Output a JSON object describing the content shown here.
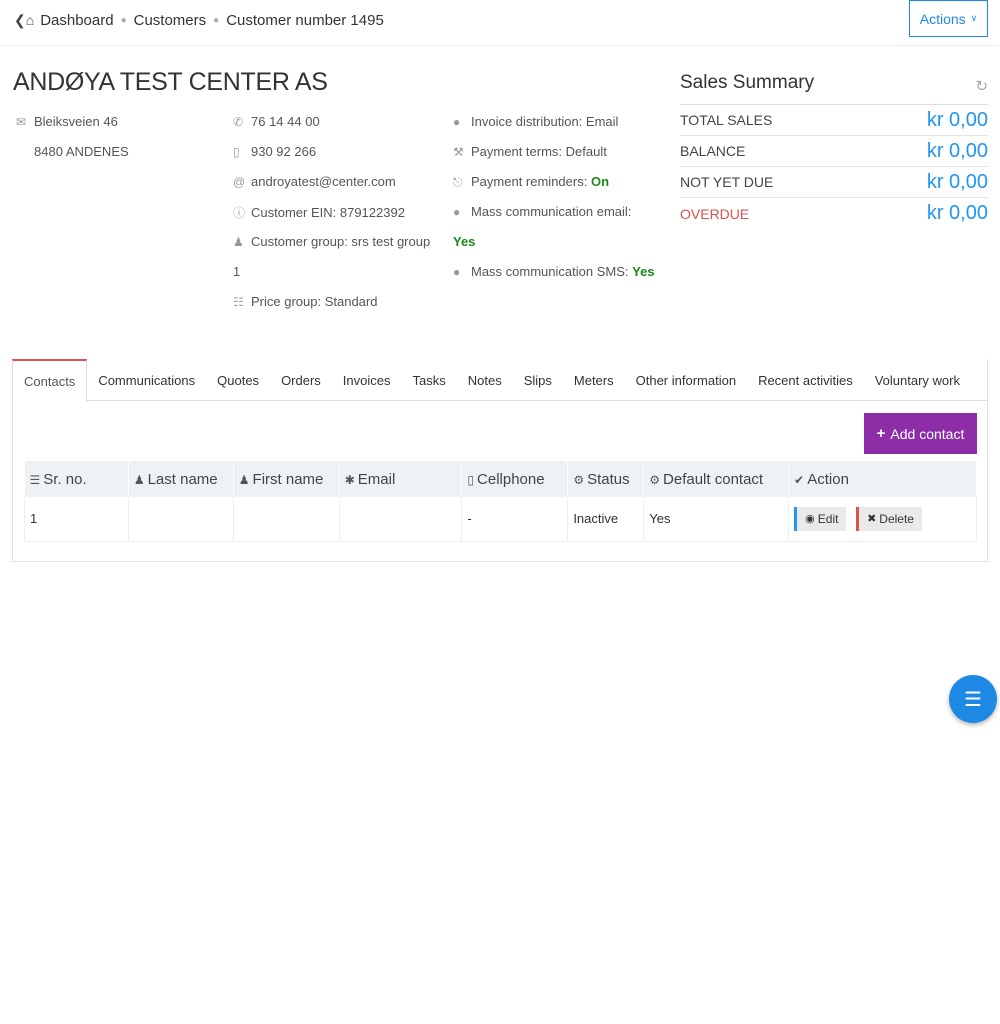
{
  "breadcrumb": {
    "items": [
      "Dashboard",
      "Customers",
      "Customer number 1495"
    ]
  },
  "actions_label": "Actions",
  "customer": {
    "name": "ANDØYA TEST CENTER AS",
    "address_line1": "Bleiksveien 46",
    "address_line2": "8480 ANDENES",
    "phone": "76 14 44 00",
    "mobile": "930 92 266",
    "email": "androyatest@center.com",
    "ein": "Customer EIN: 879122392",
    "group": "Customer group: srs test group",
    "group_cont": "1",
    "price_group": "Price group: Standard",
    "invoice_distribution": "Invoice distribution: Email",
    "payment_terms": "Payment terms: Default",
    "payment_reminders_label": "Payment reminders:",
    "payment_reminders_value": "On",
    "mass_email_label": "Mass communication email:",
    "mass_email_value": "Yes",
    "mass_sms_label": "Mass communication SMS:",
    "mass_sms_value": "Yes"
  },
  "sales_summary": {
    "title": "Sales Summary",
    "rows": [
      {
        "label": "TOTAL SALES",
        "value": "kr 0,00"
      },
      {
        "label": "BALANCE",
        "value": "kr 0,00"
      },
      {
        "label": "NOT YET DUE",
        "value": "kr 0,00"
      },
      {
        "label": "OVERDUE",
        "value": "kr 0,00"
      }
    ],
    "overdue_color": "#d9534f",
    "value_color": "#2196f3"
  },
  "tabs": [
    "Contacts",
    "Communications",
    "Quotes",
    "Orders",
    "Invoices",
    "Tasks",
    "Notes",
    "Slips",
    "Meters",
    "Other information",
    "Recent activities",
    "Voluntary work"
  ],
  "active_tab": "Contacts",
  "add_contact_label": "Add contact",
  "table": {
    "headers": [
      "Sr. no.",
      "Last name",
      "First name",
      "Email",
      "Cellphone",
      "Status",
      "Default contact",
      "Action"
    ],
    "rows": [
      {
        "sr": "1",
        "last": "",
        "first": "",
        "email": "",
        "cell": "-",
        "status": "Inactive",
        "default": "Yes"
      }
    ],
    "edit_label": "Edit",
    "delete_label": "Delete"
  },
  "colors": {
    "accent": "#1e88e5",
    "add_button": "#8e2ea7",
    "active_tab_border": "#d9534f",
    "green": "#1b8a1b"
  }
}
